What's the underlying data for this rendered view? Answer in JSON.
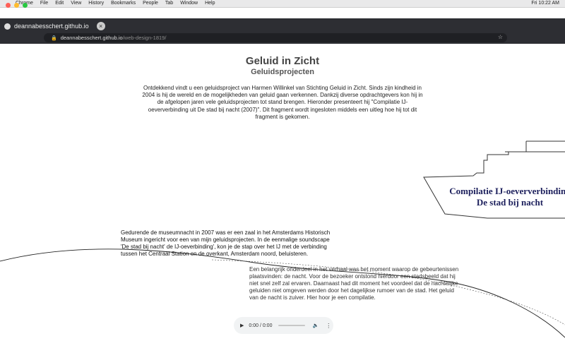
{
  "menubar": {
    "apple": "",
    "items": [
      "Chrome",
      "File",
      "Edit",
      "View",
      "History",
      "Bookmarks",
      "People",
      "Tab",
      "Window",
      "Help"
    ],
    "clock": "Fri 10:22 AM"
  },
  "browser": {
    "tab_title": "deannabesschert.github.io",
    "url_domain": "deannabesschert.github.io",
    "url_path": "/web-design-1819/"
  },
  "page": {
    "title": "Geluid in Zicht",
    "subtitle": "Geluidsprojecten",
    "intro": "Ontdekkend vindt u een geluidsproject van Harmen Willinkel van Stichting Geluid in Zicht. Sinds zijn kindheid in 2004 is hij de wereld en de mogelijkheden van geluid gaan verkennen. Dankzij diverse opdrachtgevers kon hij in de afgelopen jaren vele geluidsprojecten tot stand brengen. Hieronder presenteert hij \"Compilatie IJ-oeververbinding uit De stad bij nacht (2007)\". Dit fragment wordt ingesloten middels een uitleg hoe hij tot dit fragment is gekomen.",
    "ship_line1": "Compilatie IJ-oeververbinding",
    "ship_line2": "De stad bij nacht",
    "para1": "Gedurende de museumnacht in 2007 was er een zaal in het Amsterdams Historisch Museum ingericht voor een van mijn geluidsprojecten. In de eenmalige soundscape 'De stad bij nacht' de IJ-oeverbinding', kon je de stap over het IJ met de verbinding tussen het Centraal Station en de overkant, Amsterdam noord, beluisteren.",
    "para2": "Een belangrijk onderdeel in het verhaal was het moment waarop de gebeurtenissen plaatsvinden: de nacht. Voor de bezoeker ontstond hierdoor een stadsbeeld dat hij niet snel zelf zal ervaren. Daarnaast had dit moment het voordeel dat de nachtelijke geluiden niet omgeven werden door het dagelijkse rumoer van de stad. Het geluid van de nacht is zuiver. Hier hoor je een compilatie."
  },
  "player": {
    "play_icon": "play-icon",
    "time": "0:00 / 0:00",
    "volume_icon": "volume-icon",
    "more_icon": "more-icon",
    "progress": 0
  },
  "colors": {
    "chrome_bg": "#2d2e33",
    "ship_text": "#1c1f5c",
    "close": "#ff5f57",
    "minimize": "#febc2e",
    "maximize": "#28c840"
  }
}
